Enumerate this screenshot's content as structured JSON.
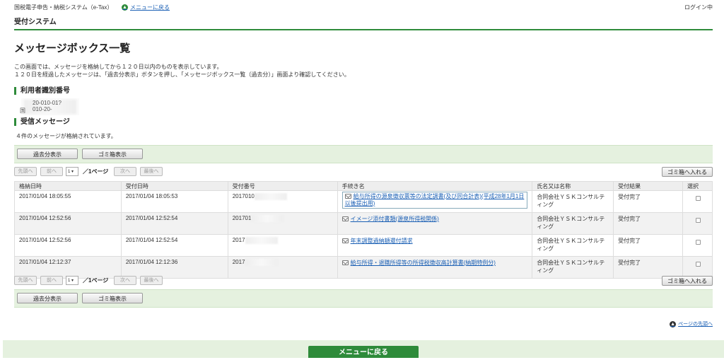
{
  "header": {
    "system_name": "国税電子申告・納税システム（e-Tax）",
    "back_to_menu_link": "メニューに戻る",
    "login_status": "ログイン中",
    "subtitle": "受付システム"
  },
  "page": {
    "title": "メッセージボックス一覧",
    "description_line1": "この画面では、メッセージを格納してから１２０日以内のものを表示しています。",
    "description_line2": "１２０日を経過したメッセージは、「過去分表示」ボタンを押し、「メッセージボックス一覧（過去分）」画面より確認してください。"
  },
  "user_id_section": {
    "heading": "利用者識別番号",
    "value_partial": "20‑010‑01?010‑20‑",
    "prefix": "国"
  },
  "messages_section": {
    "heading": "受信メッセージ",
    "count_text": "４件のメッセージが格納されています。"
  },
  "toolbar": {
    "past_button": "過去分表示",
    "trash_view_button": "ゴミ箱表示"
  },
  "pager": {
    "first": "先頭へ",
    "prev": "前へ",
    "page_select": "1",
    "page_label": "／1ページ",
    "next": "次へ",
    "last": "最後へ",
    "move_to_trash": "ゴミ箱へ入れる"
  },
  "table": {
    "headers": [
      "格納日時",
      "受付日時",
      "受付番号",
      "手続き名",
      "氏名又は名称",
      "受付結果",
      "選択"
    ],
    "rows": [
      {
        "stored": "2017/01/04 18:05:55",
        "received": "2017/01/04 18:05:53",
        "number": "2017010",
        "procedure": "給与所得の源泉徴収票等の法定調書(及び同合計表)(平成28年1月1日以後提出用)",
        "name": "合同会社ＹＳＫコンサルティング",
        "result": "受付完了"
      },
      {
        "stored": "2017/01/04 12:52:56",
        "received": "2017/01/04 12:52:54",
        "number": "201701",
        "procedure": "イメージ添付書類(源泉所得税関係)",
        "name": "合同会社ＹＳＫコンサルティング",
        "result": "受付完了"
      },
      {
        "stored": "2017/01/04 12:52:56",
        "received": "2017/01/04 12:52:54",
        "number": "2017",
        "procedure": "年末調整過納額還付請求",
        "name": "合同会社ＹＳＫコンサルティング",
        "result": "受付完了"
      },
      {
        "stored": "2017/01/04 12:12:37",
        "received": "2017/01/04 12:12:36",
        "number": "2017",
        "procedure": "給与所得・退職所得等の所得税徴収高計算書(納期特例分)",
        "name": "合同会社ＹＳＫコンサルティング",
        "result": "受付完了"
      }
    ]
  },
  "footer": {
    "page_top_link": "ページの先頭へ",
    "menu_button": "メニューに戻る"
  }
}
